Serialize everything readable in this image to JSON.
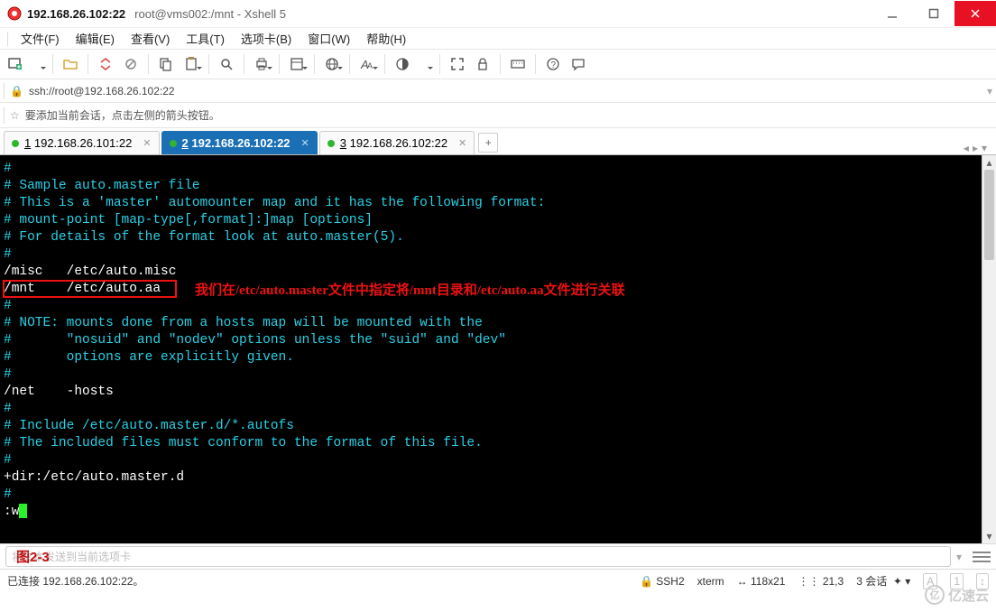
{
  "title": {
    "main": "192.168.26.102:22",
    "sub": "root@vms002:/mnt - Xshell 5"
  },
  "menu": {
    "file": "文件(F)",
    "edit": "编辑(E)",
    "view": "查看(V)",
    "tools": "工具(T)",
    "tabs": "选项卡(B)",
    "window": "窗口(W)",
    "help": "帮助(H)"
  },
  "address": {
    "text": "ssh://root@192.168.26.102:22"
  },
  "hint": {
    "text": "要添加当前会话，点击左侧的箭头按钮。"
  },
  "tabs": {
    "t1": {
      "num": "1",
      "label": "192.168.26.101:22"
    },
    "t2": {
      "num": "2",
      "label": "192.168.26.102:22"
    },
    "t3": {
      "num": "3",
      "label": "192.168.26.102:22"
    }
  },
  "terminal": {
    "lines": [
      {
        "c": "cyan",
        "t": "#"
      },
      {
        "c": "cyan",
        "t": "# Sample auto.master file"
      },
      {
        "c": "cyan",
        "t": "# This is a 'master' automounter map and it has the following format:"
      },
      {
        "c": "cyan",
        "t": "# mount-point [map-type[,format]:]map [options]"
      },
      {
        "c": "cyan",
        "t": "# For details of the format look at auto.master(5)."
      },
      {
        "c": "cyan",
        "t": "#"
      },
      {
        "c": "white",
        "t": "/misc   /etc/auto.misc"
      },
      {
        "c": "white",
        "t": "/mnt    /etc/auto.aa"
      },
      {
        "c": "cyan",
        "t": "#"
      },
      {
        "c": "cyan",
        "t": "# NOTE: mounts done from a hosts map will be mounted with the"
      },
      {
        "c": "cyan",
        "t": "#       \"nosuid\" and \"nodev\" options unless the \"suid\" and \"dev\""
      },
      {
        "c": "cyan",
        "t": "#       options are explicitly given."
      },
      {
        "c": "cyan",
        "t": "#"
      },
      {
        "c": "white",
        "t": "/net    -hosts"
      },
      {
        "c": "cyan",
        "t": "#"
      },
      {
        "c": "cyan",
        "t": "# Include /etc/auto.master.d/*.autofs"
      },
      {
        "c": "cyan",
        "t": "# The included files must conform to the format of this file."
      },
      {
        "c": "cyan",
        "t": "#"
      },
      {
        "c": "white",
        "t": "+dir:/etc/auto.master.d"
      },
      {
        "c": "cyan",
        "t": "#"
      }
    ],
    "cmd": ":w",
    "annotation": "我们在/etc/auto.master文件中指定将/mnt目录和/etc/auto.aa文件进行关联",
    "figure_label": "图2-3"
  },
  "bottom": {
    "placeholder": "将文本发送到当前选项卡"
  },
  "status": {
    "conn": "已连接 192.168.26.102:22。",
    "proto": "SSH2",
    "term": "xterm",
    "size": "118x21",
    "pos": "21,3",
    "sessions": "3 会话"
  },
  "watermark": {
    "text": "亿速云"
  }
}
